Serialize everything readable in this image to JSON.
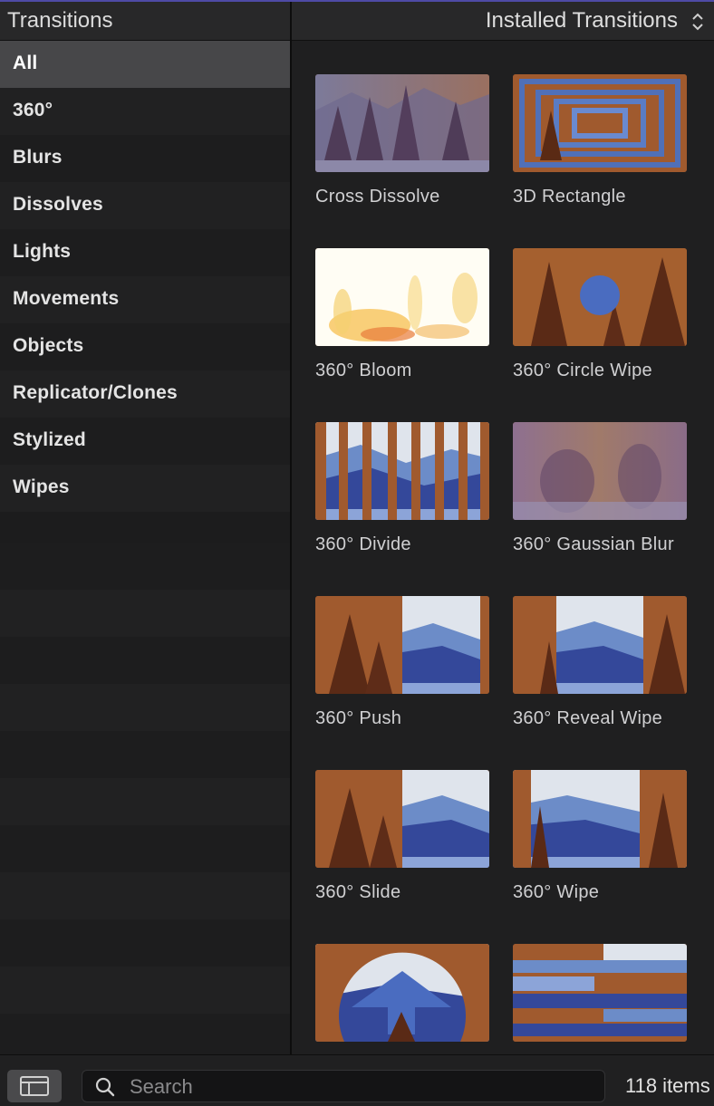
{
  "sidebar": {
    "title": "Transitions",
    "categories": [
      "All",
      "360°",
      "Blurs",
      "Dissolves",
      "Lights",
      "Movements",
      "Objects",
      "Replicator/Clones",
      "Stylized",
      "Wipes"
    ],
    "selected": "All"
  },
  "browser": {
    "source_label": "Installed Transitions",
    "items": [
      {
        "name": "Cross Dissolve"
      },
      {
        "name": "3D Rectangle"
      },
      {
        "name": "360° Bloom"
      },
      {
        "name": "360° Circle Wipe"
      },
      {
        "name": "360° Divide"
      },
      {
        "name": "360° Gaussian Blur"
      },
      {
        "name": "360° Push"
      },
      {
        "name": "360° Reveal Wipe"
      },
      {
        "name": "360° Slide"
      },
      {
        "name": "360° Wipe"
      },
      {
        "name": ""
      },
      {
        "name": ""
      }
    ]
  },
  "footer": {
    "search_placeholder": "Search",
    "item_count": "118 items"
  },
  "colors": {
    "accent_line": "#4e4aa6",
    "selected_row": "#474749",
    "wood": "#8a4a28",
    "mountain_blue": "#3c54a0"
  }
}
